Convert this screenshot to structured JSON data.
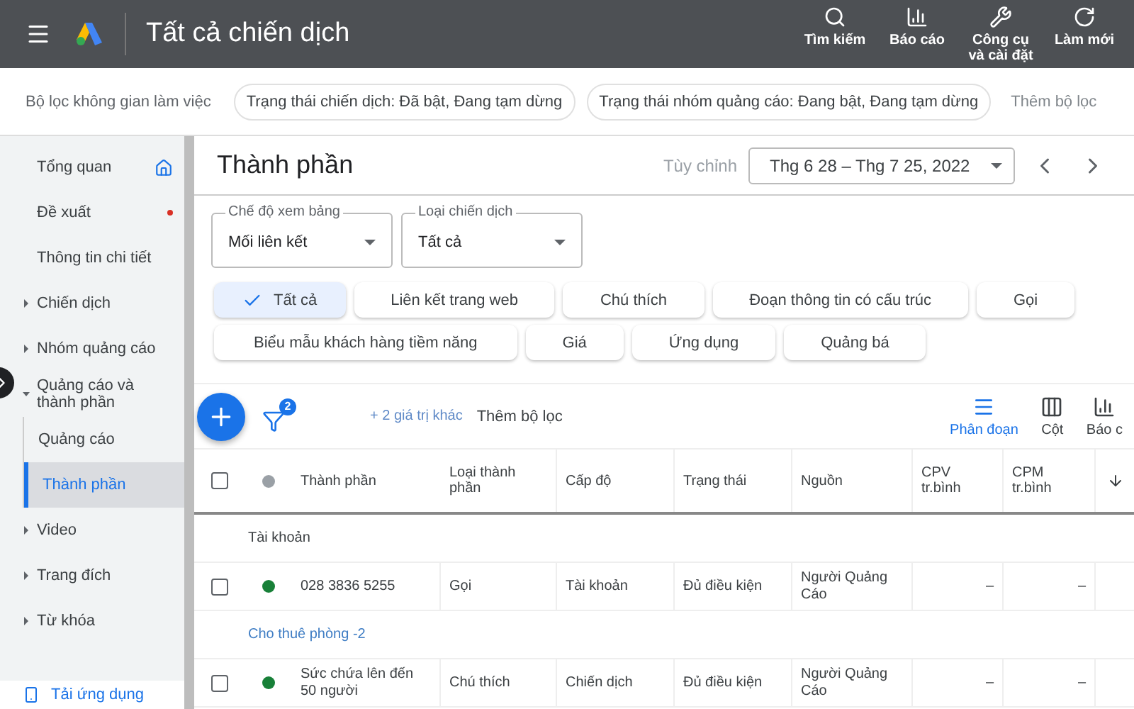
{
  "topbar": {
    "title": "Tất cả chiến dịch",
    "actions": [
      {
        "label": "Tìm kiếm",
        "kind": "search"
      },
      {
        "label": "Báo cáo",
        "kind": "report"
      },
      {
        "label": "Công cụ và cài đặt",
        "kind": "tools"
      },
      {
        "label": "Làm mới",
        "kind": "refresh"
      }
    ]
  },
  "filter_bar": {
    "label": "Bộ lọc không gian làm việc",
    "filters": [
      "Trạng thái chiến dịch: Đã bật, Đang tạm dừng",
      "Trạng thái nhóm quảng cáo: Đang bật, Đang tạm dừng"
    ],
    "add_filter": "Thêm bộ lọc"
  },
  "sidebar": {
    "items": [
      {
        "label": "Tổng quan",
        "kind": "home",
        "selected": false
      },
      {
        "label": "Đề xuất",
        "kind": "alert",
        "selected": false
      },
      {
        "label": "Thông tin chi tiết",
        "kind": "plain",
        "selected": false
      },
      {
        "label": "Chiến dịch",
        "kind": "group",
        "expanded": false,
        "selected": false
      },
      {
        "label": "Nhóm quảng cáo",
        "kind": "group",
        "expanded": false,
        "selected": false
      },
      {
        "label": "Quảng cáo và thành phần",
        "kind": "group",
        "expanded": true,
        "selected": false,
        "children": [
          {
            "label": "Quảng cáo",
            "selected": false
          },
          {
            "label": "Thành phần",
            "selected": true
          }
        ]
      },
      {
        "label": "Video",
        "kind": "group",
        "expanded": false,
        "selected": false
      },
      {
        "label": "Trang đích",
        "kind": "group",
        "expanded": false,
        "selected": false
      },
      {
        "label": "Từ khóa",
        "kind": "group",
        "expanded": false,
        "selected": false
      }
    ],
    "app_link": "Tải ứng dụng"
  },
  "page": {
    "title": "Thành phần",
    "date_label": "Tùy chỉnh",
    "date_range": "Thg 6 28 – Thg 7 25, 2022"
  },
  "selects": [
    {
      "label": "Chế độ xem bảng",
      "value": "Mối liên kết"
    },
    {
      "label": "Loại chiến dịch",
      "value": "Tất cả"
    }
  ],
  "chips": [
    [
      {
        "label": "Tất cả",
        "selected": true
      },
      {
        "label": "Liên kết trang web",
        "selected": false
      },
      {
        "label": "Chú thích",
        "selected": false
      },
      {
        "label": "Đoạn thông tin có cấu trúc",
        "selected": false
      },
      {
        "label": "Gọi",
        "selected": false
      }
    ],
    [
      {
        "label": "Biểu mẫu khách hàng tiềm năng",
        "selected": false
      },
      {
        "label": "Giá",
        "selected": false
      },
      {
        "label": "Ứng dụng",
        "selected": false
      },
      {
        "label": "Quảng bá",
        "selected": false
      }
    ]
  ],
  "toolbar": {
    "filter_count": "2",
    "more_values": "+ 2 giá trị khác",
    "add_filter": "Thêm bộ lọc",
    "tools": [
      {
        "label": "Phân đoạn",
        "kind": "segment",
        "selected": true
      },
      {
        "label": "Cột",
        "kind": "columns",
        "selected": false
      },
      {
        "label": "Báo c",
        "kind": "report",
        "selected": false
      }
    ]
  },
  "table": {
    "header_checked": false,
    "columns": [
      "Thành phần",
      "Loại thành phần",
      "Cấp độ",
      "Trạng thái",
      "Nguồn",
      "CPV tr.bình",
      "CPM tr.bình"
    ],
    "rows": [
      {
        "kind": "group",
        "label": "Tài khoản",
        "link": false
      },
      {
        "kind": "data",
        "checked": false,
        "color": "#188038",
        "cells": [
          "028 3836 5255",
          "Gọi",
          "Tài khoản",
          "Đủ điều kiện",
          "Người Quảng Cáo",
          "–",
          "–"
        ]
      },
      {
        "kind": "group",
        "label": "Cho thuê phòng -2",
        "link": true
      },
      {
        "kind": "data",
        "checked": false,
        "color": "#188038",
        "cells": [
          "Sức chứa lên đến 50 người",
          "Chú thích",
          "Chiến dịch",
          "Đủ điều kiện",
          "Người Quảng Cáo",
          "–",
          "–"
        ]
      }
    ]
  }
}
